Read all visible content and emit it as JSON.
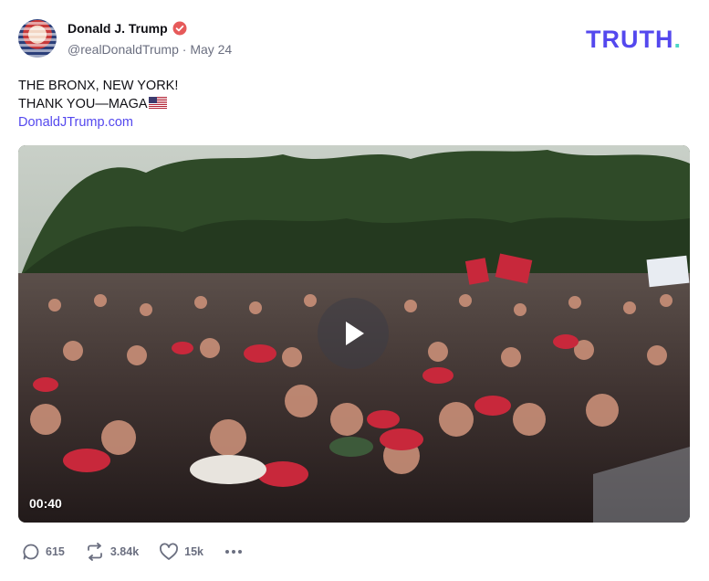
{
  "post": {
    "author": {
      "display_name": "Donald J. Trump",
      "handle": "@realDonaldTrump",
      "date": "May 24",
      "separator": "·"
    },
    "brand": {
      "wordmark": "TRUTH",
      "dot": "."
    },
    "text": {
      "line1": "THE BRONX, NEW YORK!",
      "line2": "THANK YOU—MAGA",
      "link": "DonaldJTrump.com"
    },
    "video": {
      "duration": "00:40"
    },
    "actions": {
      "replies": "615",
      "retruths": "3.84k",
      "likes": "15k"
    }
  },
  "colors": {
    "accent": "#5448ee",
    "verified": "#e65a5a",
    "brand_dot": "#4bd6c6",
    "meta": "#6b6f80"
  },
  "icons": [
    "verified-badge-icon",
    "us-flag-icon",
    "play-icon",
    "reply-icon",
    "retruth-icon",
    "like-icon",
    "more-icon"
  ]
}
